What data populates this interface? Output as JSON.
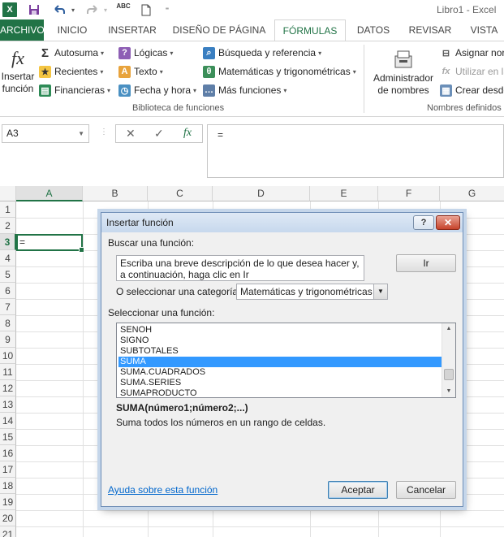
{
  "app": {
    "title": "Libro1 - Excel",
    "logo_letter": "X"
  },
  "quick_access": {
    "save_icon": "save-icon",
    "undo_icon": "undo-icon",
    "redo_icon": "redo-icon",
    "spelling_label": "ABC",
    "new_icon": "new-document-icon"
  },
  "tabs": [
    "ARCHIVO",
    "INICIO",
    "INSERTAR",
    "DISEÑO DE PÁGINA",
    "FÓRMULAS",
    "DATOS",
    "REVISAR",
    "VISTA"
  ],
  "ribbon": {
    "insert_function": {
      "line1": "Insertar",
      "line2": "función",
      "glyph": "fx"
    },
    "autosum": "Autosuma",
    "recent": "Recientes",
    "financial": "Financieras",
    "logical": "Lógicas",
    "text": "Texto",
    "datetime": "Fecha y hora",
    "lookup": "Búsqueda y referencia",
    "math": "Matemáticas y trigonométricas",
    "more": "Más funciones",
    "group_library": "Biblioteca de funciones",
    "name_manager": {
      "line1": "Administrador",
      "line2": "de nombres"
    },
    "assign_name": "Asignar nor",
    "use_in_formula": "Utilizar en la",
    "create_from_selection": "Crear desde",
    "group_names": "Nombres definidos"
  },
  "formula_bar": {
    "name_box": "A3",
    "formula": "="
  },
  "grid": {
    "columns": [
      "A",
      "B",
      "C",
      "D",
      "E",
      "F",
      "G"
    ],
    "rows": [
      "1",
      "2",
      "3",
      "4",
      "5",
      "6",
      "7",
      "8",
      "9",
      "10",
      "11",
      "12",
      "13",
      "14",
      "15",
      "16",
      "17",
      "18",
      "19",
      "20",
      "21"
    ],
    "active_cell_value": "="
  },
  "dialog": {
    "title": "Insertar función",
    "help_label": "?",
    "close_label": "✕",
    "search_label": "Buscar una función:",
    "search_text": "Escriba una breve descripción de lo que desea hacer y, a continuación, haga clic en Ir",
    "go_button": "Ir",
    "category_label": "O seleccionar una categoría:",
    "category_value": "Matemáticas y trigonométricas",
    "select_label": "Seleccionar una función:",
    "functions": [
      "SENOH",
      "SIGNO",
      "SUBTOTALES",
      "SUMA",
      "SUMA.CUADRADOS",
      "SUMA.SERIES",
      "SUMAPRODUCTO"
    ],
    "selected_function": "SUMA",
    "signature": "SUMA(número1;número2;...)",
    "description": "Suma todos los números en un rango de celdas.",
    "help_link": "Ayuda sobre esta función",
    "ok_button": "Aceptar",
    "cancel_button": "Cancelar"
  },
  "colors": {
    "excel_green": "#217346",
    "selection_blue": "#3399ff",
    "link_blue": "#0066cc"
  }
}
